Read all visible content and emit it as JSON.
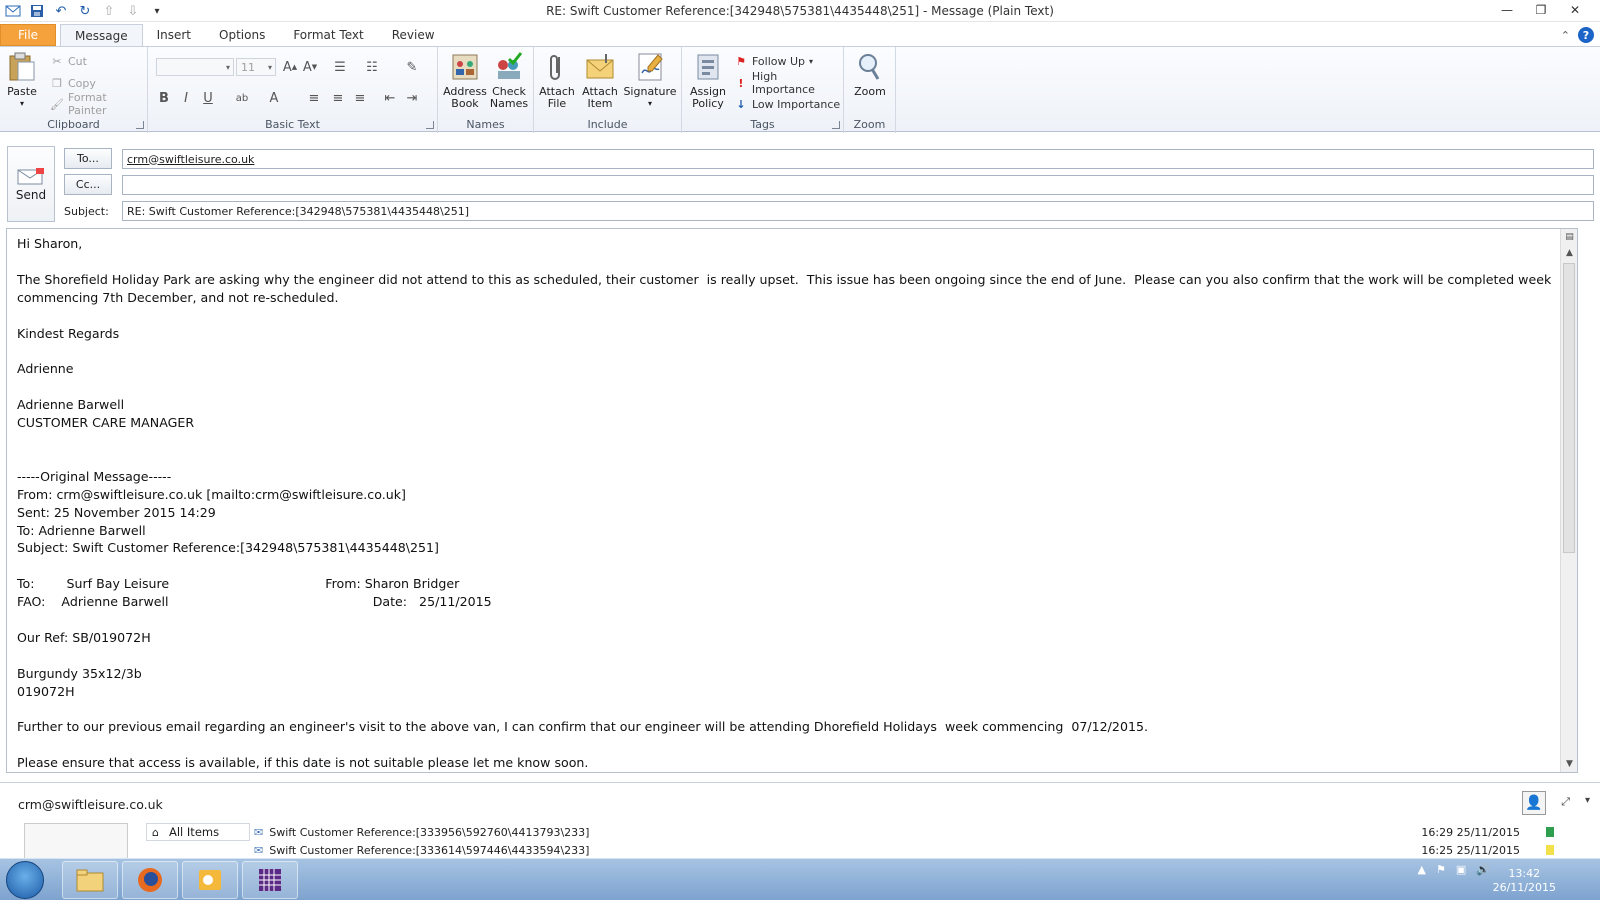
{
  "window": {
    "title": "RE: Swift Customer Reference:[342948\\575381\\4435448\\251]  -  Message (Plain Text)"
  },
  "tabs": [
    "File",
    "Message",
    "Insert",
    "Options",
    "Format Text",
    "Review"
  ],
  "ribbon": {
    "clipboard": {
      "label": "Clipboard",
      "paste": "Paste",
      "cut": "Cut",
      "copy": "Copy",
      "format_painter": "Format Painter"
    },
    "basic_text": {
      "label": "Basic Text",
      "font_size": "11"
    },
    "names": {
      "label": "Names",
      "address_book": "Address\nBook",
      "check_names": "Check\nNames"
    },
    "include": {
      "label": "Include",
      "attach_file": "Attach\nFile",
      "attach_item": "Attach\nItem",
      "signature": "Signature"
    },
    "tags": {
      "label": "Tags",
      "assign_policy": "Assign\nPolicy",
      "follow_up": "Follow Up",
      "high_importance": "High Importance",
      "low_importance": "Low Importance"
    },
    "zoom": {
      "label": "Zoom",
      "zoom": "Zoom"
    }
  },
  "header": {
    "send": "Send",
    "to_button": "To...",
    "cc_button": "Cc...",
    "subject_label": "Subject:",
    "to_value": "crm@swiftleisure.co.uk",
    "cc_value": "",
    "subject_value": "RE: Swift Customer Reference:[342948\\575381\\4435448\\251]"
  },
  "body": {
    "text": "Hi Sharon,\n\nThe Shorefield Holiday Park are asking why the engineer did not attend to this as scheduled, their customer  is really upset.  This issue has been ongoing since the end of June.  Please can you also confirm that the work will be completed week commencing 7th December, and not re-scheduled.\n\nKindest Regards\n\nAdrienne\n\nAdrienne Barwell\nCUSTOMER CARE MANAGER\n\n\n-----Original Message-----\nFrom: crm@swiftleisure.co.uk [mailto:crm@swiftleisure.co.uk]\nSent: 25 November 2015 14:29\nTo: Adrienne Barwell\nSubject: Swift Customer Reference:[342948\\575381\\4435448\\251]\n\nTo:        Surf Bay Leisure                                       From: Sharon Bridger\nFAO:    Adrienne Barwell                                                   Date:   25/11/2015\n\nOur Ref: SB/019072H\n\nBurgundy 35x12/3b\n019072H\n\nFurther to our previous email regarding an engineer's visit to the above van, I can confirm that our engineer will be attending Dhorefield Holidays  week commencing  07/12/2015.\n\nPlease ensure that access is available, if this date is not suitable please let me know soon."
  },
  "people_pane": {
    "name": "crm@swiftleisure.co.uk",
    "all_items": "All Items",
    "items": [
      {
        "subject": "Swift Customer Reference:[333956\\592760\\4413793\\233]",
        "time": "16:29  25/11/2015",
        "color": "#2e9e4f"
      },
      {
        "subject": "Swift Customer Reference:[333614\\597446\\4433594\\233]",
        "time": "16:25  25/11/2015",
        "color": "#f3e04a"
      }
    ]
  },
  "taskbar": {
    "time": "13:42",
    "date": "26/11/2015"
  }
}
